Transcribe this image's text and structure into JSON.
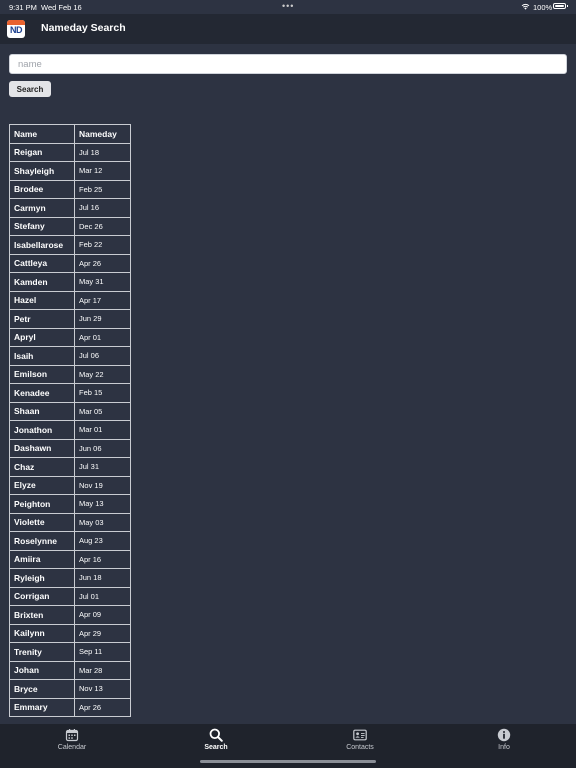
{
  "status": {
    "time": "9:31 PM",
    "date": "Wed Feb 16",
    "dots": "•••",
    "battery": "100%"
  },
  "nav": {
    "logo_text": "ND",
    "title": "Nameday Search"
  },
  "search": {
    "placeholder": "name",
    "value": "",
    "button_label": "Search"
  },
  "table": {
    "headers": [
      "Name",
      "Nameday"
    ],
    "rows": [
      [
        "Reigan",
        "Jul 18"
      ],
      [
        "Shayleigh",
        "Mar 12"
      ],
      [
        "Brodee",
        "Feb 25"
      ],
      [
        "Carmyn",
        "Jul 16"
      ],
      [
        "Stefany",
        "Dec 26"
      ],
      [
        "Isabellarose",
        "Feb 22"
      ],
      [
        "Cattleya",
        "Apr 26"
      ],
      [
        "Kamden",
        "May 31"
      ],
      [
        "Hazel",
        "Apr 17"
      ],
      [
        "Petr",
        "Jun 29"
      ],
      [
        "Apryl",
        "Apr 01"
      ],
      [
        "Isaih",
        "Jul 06"
      ],
      [
        "Emilson",
        "May 22"
      ],
      [
        "Kenadee",
        "Feb 15"
      ],
      [
        "Shaan",
        "Mar 05"
      ],
      [
        "Jonathon",
        "Mar 01"
      ],
      [
        "Dashawn",
        "Jun 06"
      ],
      [
        "Chaz",
        "Jul 31"
      ],
      [
        "Elyze",
        "Nov 19"
      ],
      [
        "Peighton",
        "May 13"
      ],
      [
        "Violette",
        "May 03"
      ],
      [
        "Roselynne",
        "Aug 23"
      ],
      [
        "Amiira",
        "Apr 16"
      ],
      [
        "Ryleigh",
        "Jun 18"
      ],
      [
        "Corrigan",
        "Jul 01"
      ],
      [
        "Brixten",
        "Apr 09"
      ],
      [
        "Kailynn",
        "Apr 29"
      ],
      [
        "Trenity",
        "Sep 11"
      ],
      [
        "Johan",
        "Mar 28"
      ],
      [
        "Bryce",
        "Nov 13"
      ],
      [
        "Emmary",
        "Apr 26"
      ]
    ]
  },
  "tabs": [
    {
      "label": "Calendar",
      "icon": "calendar-icon",
      "active": false
    },
    {
      "label": "Search",
      "icon": "search-icon",
      "active": true
    },
    {
      "label": "Contacts",
      "icon": "contact-card-icon",
      "active": false
    },
    {
      "label": "Info",
      "icon": "info-icon",
      "active": false
    }
  ],
  "colors": {
    "background": "#2d3342",
    "nav_bar": "#232833",
    "tab_bar": "#1f232c",
    "logo_orange": "#e9622f",
    "logo_blue": "#1b3f8f"
  }
}
